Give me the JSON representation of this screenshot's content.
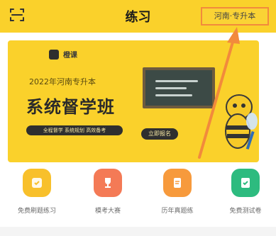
{
  "header": {
    "title": "练习",
    "exam_selector_label": "河南·专升本",
    "accent_color": "#FAD12B",
    "highlight_color": "#F28A3C"
  },
  "banner": {
    "brand_name": "橙课",
    "subtitle": "2022年河南专升本",
    "headline": "系统督学班",
    "tagline": "全程督学 系统规划 高效备考",
    "cta_label": "立即报名"
  },
  "quick_nav": {
    "items": [
      {
        "label": "免费刷题练习",
        "icon": "practice-icon",
        "color": "#F8C02B"
      },
      {
        "label": "模考大赛",
        "icon": "trophy-icon",
        "color": "#F47A56"
      },
      {
        "label": "历年真题练",
        "icon": "document-icon",
        "color": "#F79A3C"
      },
      {
        "label": "免费测试卷",
        "icon": "checklist-icon",
        "color": "#2DBB7F"
      }
    ]
  }
}
